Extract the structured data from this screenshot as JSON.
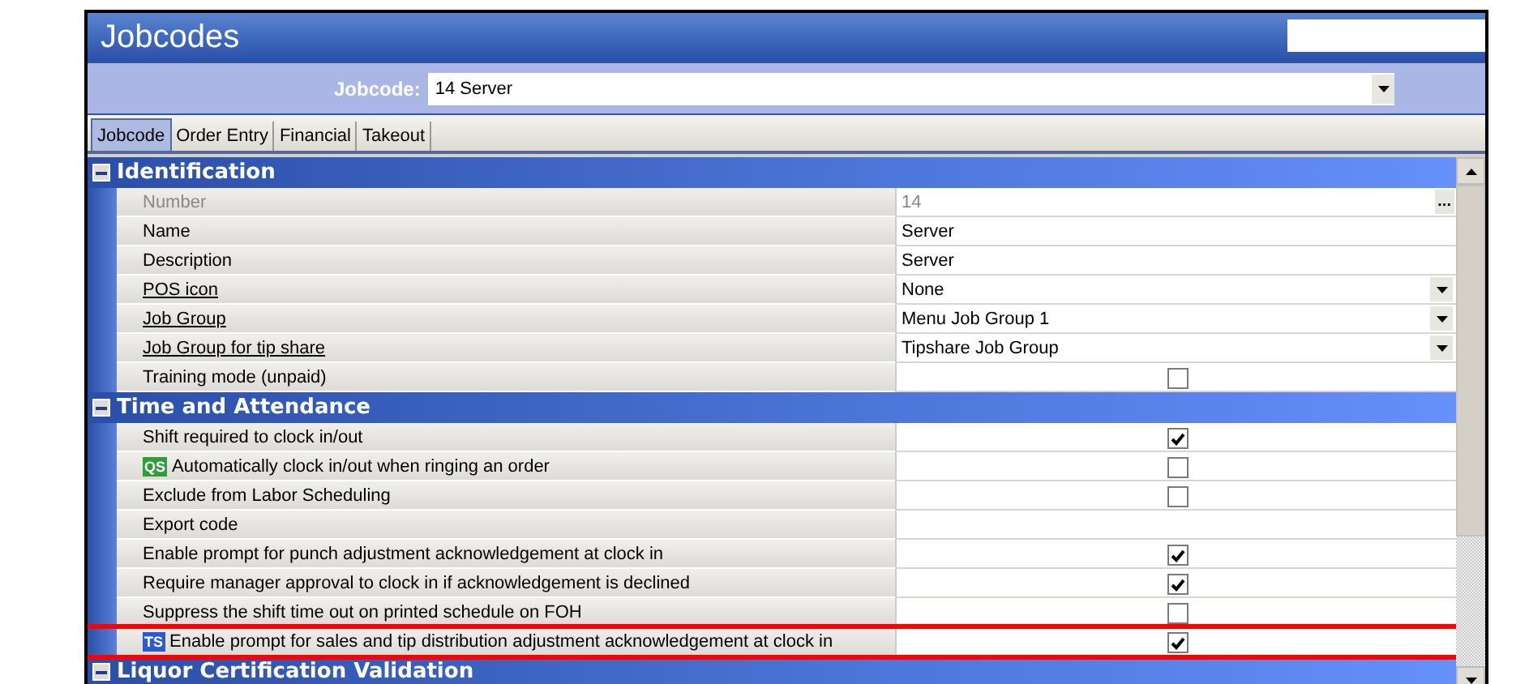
{
  "window": {
    "title": "Jobcodes"
  },
  "selector": {
    "label": "Jobcode:",
    "value": "14 Server"
  },
  "tabs": [
    {
      "label": "Jobcode",
      "selected": true
    },
    {
      "label": "Order Entry",
      "selected": false
    },
    {
      "label": "Financial",
      "selected": false
    },
    {
      "label": "Takeout",
      "selected": false
    }
  ],
  "sections": [
    {
      "title": "Identification",
      "expanded": true,
      "rows": [
        {
          "label": "Number",
          "link": false,
          "disabled": true,
          "kind": "browse",
          "value": "14",
          "button": "..."
        },
        {
          "label": "Name",
          "link": false,
          "disabled": false,
          "kind": "text",
          "value": "Server"
        },
        {
          "label": "Description",
          "link": false,
          "disabled": false,
          "kind": "text",
          "value": "Server"
        },
        {
          "label": "POS icon",
          "link": true,
          "disabled": false,
          "kind": "dropdown",
          "value": "None"
        },
        {
          "label": "Job Group",
          "link": true,
          "disabled": false,
          "kind": "dropdown",
          "value": "Menu Job Group 1"
        },
        {
          "label": "Job Group for tip share",
          "link": true,
          "disabled": false,
          "kind": "dropdown",
          "value": "Tipshare Job Group"
        },
        {
          "label": "Training mode (unpaid)",
          "link": false,
          "disabled": false,
          "kind": "checkbox",
          "checked": false
        }
      ]
    },
    {
      "title": "Time and Attendance",
      "expanded": true,
      "rows": [
        {
          "label": "Shift required to clock in/out",
          "link": false,
          "disabled": false,
          "kind": "checkbox",
          "checked": true
        },
        {
          "label": "Automatically clock in/out when ringing an order",
          "link": false,
          "disabled": false,
          "kind": "checkbox",
          "checked": false,
          "badge": "QS",
          "color": "#2e9e3a"
        },
        {
          "label": "Exclude from Labor Scheduling",
          "link": false,
          "disabled": false,
          "kind": "checkbox",
          "checked": false
        },
        {
          "label": "Export code",
          "link": false,
          "disabled": false,
          "kind": "text"
        },
        {
          "label": "Enable prompt for punch adjustment acknowledgement at clock in",
          "link": false,
          "disabled": false,
          "kind": "checkbox",
          "checked": true
        },
        {
          "label": "Require manager approval to clock in if acknowledgement is declined",
          "link": false,
          "disabled": false,
          "kind": "checkbox",
          "checked": true
        },
        {
          "label": "Suppress the shift time out on printed schedule on FOH",
          "link": false,
          "disabled": false,
          "kind": "checkbox",
          "checked": false
        },
        {
          "label": "Enable prompt for sales and tip distribution adjustment acknowledgement at clock in",
          "link": false,
          "disabled": false,
          "kind": "checkbox",
          "checked": true,
          "badge": "TS",
          "color": "#2a5bd7",
          "highlighted": true
        }
      ]
    },
    {
      "title": "Liquor Certification Validation",
      "expanded": true
    }
  ]
}
